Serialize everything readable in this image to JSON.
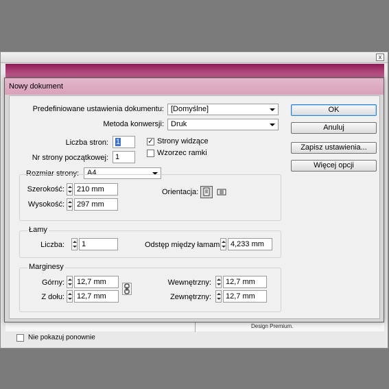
{
  "background": {
    "note": "Design Premium.",
    "dont_show_label": "Nie pokazuj ponownie",
    "close_glyph": "x"
  },
  "dialog": {
    "title": "Nowy dokument",
    "preset_label": "Predefiniowane ustawienia dokumentu:",
    "preset_value": "[Domyślne]",
    "intent_label": "Metoda konwersji:",
    "intent_value": "Druk",
    "pages_label": "Liczba stron:",
    "pages_value": "1",
    "start_page_label": "Nr strony początkowej:",
    "start_page_value": "1",
    "facing_pages_label": "Strony widzące",
    "facing_pages_checked": true,
    "master_frame_label": "Wzorzec ramki",
    "master_frame_checked": false,
    "page_size_label": "Rozmiar strony:",
    "page_size_value": "A4",
    "width_label": "Szerokość:",
    "width_value": "210 mm",
    "height_label": "Wysokość:",
    "height_value": "297 mm",
    "orientation_label": "Orientacja:",
    "orientation_icons": [
      "portrait-icon",
      "landscape-icon"
    ],
    "columns_group_title": "Łamy",
    "columns_number_label": "Liczba:",
    "columns_number_value": "1",
    "gutter_label": "Odstęp między łamami:",
    "gutter_value": "4,233 mm",
    "margins_group_title": "Marginesy",
    "top_label": "Górny:",
    "top_value": "12,7 mm",
    "bottom_label": "Z dołu:",
    "bottom_value": "12,7 mm",
    "inside_label": "Wewnętrzny:",
    "inside_value": "12,7 mm",
    "outside_label": "Zewnętrzny:",
    "outside_value": "12,7 mm",
    "link_icon": "chain-link-icon"
  },
  "buttons": {
    "ok": "OK",
    "cancel": "Anuluj",
    "save_preset": "Zapisz ustawienia...",
    "more_options": "Więcej opcji"
  },
  "colors": {
    "banner": "#b04d7f",
    "dialog_titlebar": "#d8a1ba",
    "selection": "#3a6fd8",
    "default_button_border": "#2f7fd0"
  }
}
